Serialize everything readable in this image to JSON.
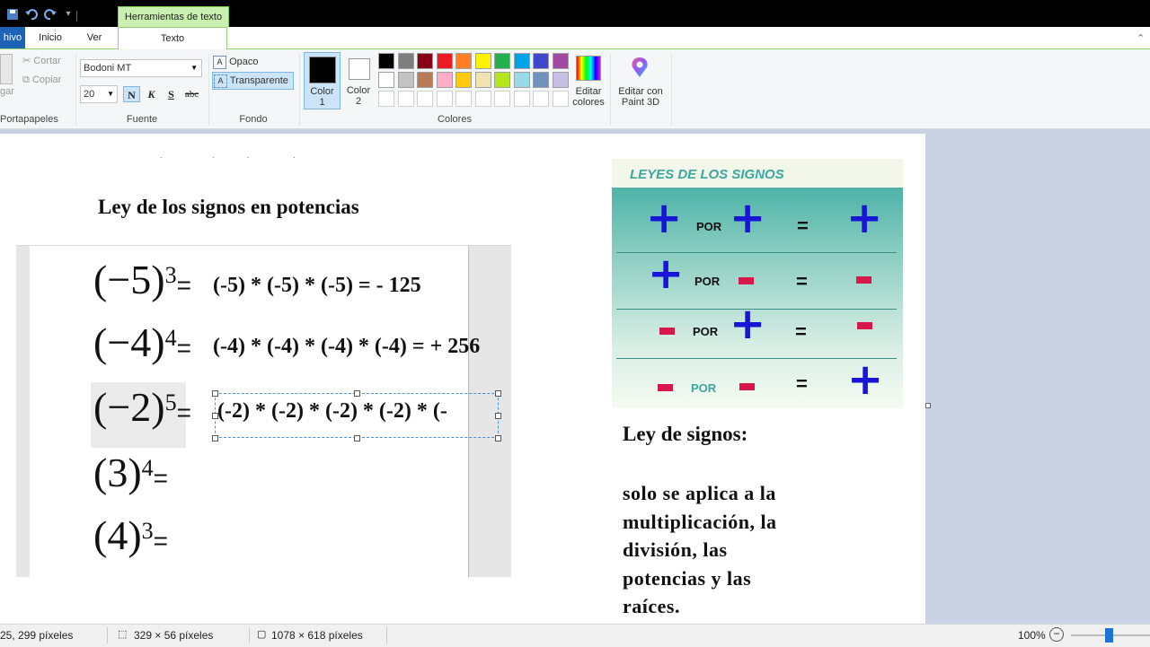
{
  "context_tab": "Herramientas de texto",
  "tabs": {
    "file": "hivo",
    "home": "Inicio",
    "view": "Ver",
    "text": "Texto"
  },
  "clipboard": {
    "paste": "gar",
    "cut": "Cortar",
    "copy": "Copiar",
    "group": "Portapapeles"
  },
  "font": {
    "family": "Bodoni MT",
    "size": "20",
    "bold": "N",
    "italic": "K",
    "underline": "S",
    "strike": "abc",
    "group": "Fuente"
  },
  "background": {
    "opaque": "Opaco",
    "transparent": "Transparente",
    "group": "Fondo"
  },
  "colors": {
    "color1": "Color\n1",
    "color1_a": "Color",
    "color1_b": "1",
    "color2_a": "Color",
    "color2_b": "2",
    "edit_a": "Editar",
    "edit_b": "colores",
    "paint3d_a": "Editar con",
    "paint3d_b": "Paint 3D",
    "group": "Colores",
    "row1": [
      "#000000",
      "#7f7f7f",
      "#880015",
      "#ed1c24",
      "#ff7f27",
      "#fff200",
      "#22b14c",
      "#00a2e8",
      "#3f48cc",
      "#a349a4"
    ],
    "row2": [
      "#ffffff",
      "#c3c3c3",
      "#b97a57",
      "#ffaec9",
      "#ffc90e",
      "#efe4b0",
      "#b5e61d",
      "#99d9ea",
      "#7092be",
      "#c8bfe7"
    ]
  },
  "doc": {
    "heading": "Ley de los signos en potencias",
    "rows": [
      {
        "base": "(−5)",
        "exp": "3",
        "eq": "=",
        "expansion": "(-5) * (-5) * (-5) = -  125"
      },
      {
        "base": "(−4)",
        "exp": "4",
        "eq": "=",
        "expansion": "(-4) * (-4) * (-4) * (-4) = + 256"
      },
      {
        "base": "(−2)",
        "exp": "5",
        "eq": "=",
        "expansion": "(-2) * (-2) * (-2) * (-2) * (-"
      },
      {
        "base": "(3)",
        "exp": "4",
        "eq": "=",
        "expansion": ""
      },
      {
        "base": "(4)",
        "exp": "3",
        "eq": "=",
        "expansion": ""
      }
    ],
    "signs_title": "LEYES DE LOS SIGNOS",
    "por": "POR",
    "equals": "=",
    "rule_title": "Ley de signos:",
    "rule_lines": [
      "solo se aplica a la",
      "multiplicación, la",
      "división, las",
      "potencias y las",
      "raíces."
    ]
  },
  "status": {
    "cursor": "25, 299 píxeles",
    "selection": "329 × 56 píxeles",
    "image_size": "1078 × 618 píxeles",
    "zoom": "100%"
  }
}
